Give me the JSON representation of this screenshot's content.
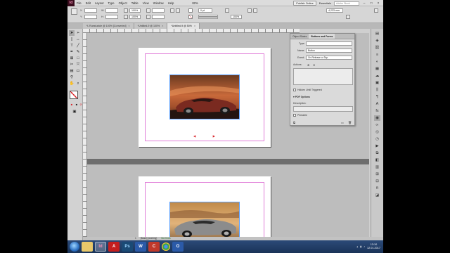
{
  "app": {
    "icon_text": "Id",
    "menus": [
      "File",
      "Edit",
      "Layout",
      "Type",
      "Object",
      "Table",
      "View",
      "Window",
      "Help"
    ],
    "zoom": "82%",
    "publish_button": "Publish Online",
    "workspace": "Essentials",
    "search_placeholder": "Adobe Stock"
  },
  "control": {
    "x_label": "X:",
    "y_label": "Y:",
    "w_label": "W:",
    "h_label": "H:",
    "x_value": "",
    "y_value": "",
    "stroke_weight": "0 pt",
    "percent": "100%",
    "size_field": "4,233 mm"
  },
  "tabs": [
    {
      "label": "*L'Ruestunkle @ 100% [Converted]",
      "active": false
    },
    {
      "label": "*Untitled-9 @ 100%",
      "active": false
    },
    {
      "label": "*Untitled-9 @ 50%",
      "active": true
    }
  ],
  "tools": [
    "selection-tool",
    "direct-selection-tool",
    "page-tool",
    "gap-tool",
    "type-tool",
    "line-tool",
    "pen-tool",
    "pencil-tool",
    "rectangle-frame-tool",
    "rectangle-tool",
    "scissors-tool",
    "free-transform-tool",
    "gradient-tool",
    "note-tool",
    "eyedropper-tool",
    "hand-tool",
    "zoom-tool"
  ],
  "bf_panel": {
    "tabs": [
      "Object States",
      "Buttons and Forms"
    ],
    "type_label": "Type:",
    "type_value": "",
    "name_label": "Name:",
    "name_value": "Button",
    "event_label": "Event:",
    "event_value": "On Release or Tap",
    "actions_label": "Actions:",
    "hidden_label": "Hidden Until Triggered",
    "pdf_options": "PDF Options",
    "description_label": "Description:",
    "printable_label": "Printable"
  },
  "status": {
    "page": "1",
    "style": "[Basic] (working)",
    "errors": "No errors"
  },
  "taskbar": {
    "apps": [
      {
        "name": "explorer",
        "text": "",
        "color": "#e8c86a"
      },
      {
        "name": "indesign",
        "text": "Id",
        "color": "#5a0f2b"
      },
      {
        "name": "acrobat",
        "text": "A",
        "color": "#c41e1e"
      },
      {
        "name": "photoshop",
        "text": "Ps",
        "color": "#1a4a75"
      },
      {
        "name": "word",
        "text": "W",
        "color": "#2b5aa8"
      },
      {
        "name": "app-c",
        "text": "C",
        "color": "#c0392b"
      },
      {
        "name": "chrome",
        "text": "",
        "color": "#3aa64a"
      },
      {
        "name": "app-o",
        "text": "O",
        "color": "#2b5aa8"
      }
    ],
    "time": "13:10",
    "date": "12.01.2017"
  },
  "colors": {
    "accent_magenta": "#e07cd8",
    "arrow_red": "#d8242a"
  }
}
